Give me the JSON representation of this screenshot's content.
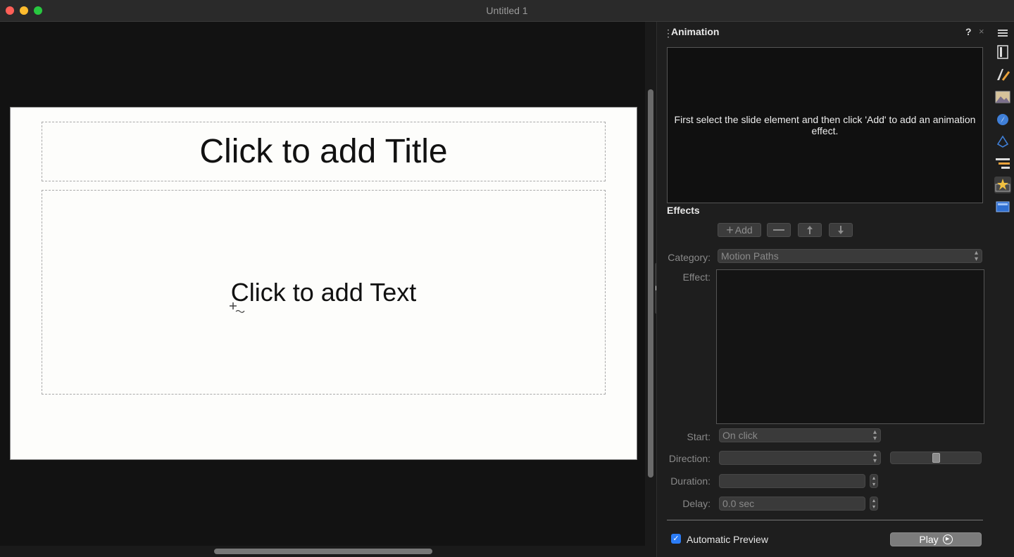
{
  "window": {
    "title": "Untitled 1"
  },
  "slide": {
    "title_placeholder": "Click to add Title",
    "text_placeholder": "Click to add Text"
  },
  "panel": {
    "title": "Animation",
    "help": "?",
    "close": "×",
    "preview_message": "First select the slide element and then click 'Add' to add an animation effect.",
    "effects_heading": "Effects",
    "toolbar": {
      "add_label": "Add"
    },
    "category": {
      "label": "Category:",
      "value": "Motion Paths"
    },
    "effect": {
      "label": "Effect:"
    },
    "start": {
      "label": "Start:",
      "value": "On click"
    },
    "direction": {
      "label": "Direction:",
      "value": ""
    },
    "duration": {
      "label": "Duration:",
      "value": ""
    },
    "delay": {
      "label": "Delay:",
      "value": "0.0 sec"
    },
    "automatic_preview": {
      "label": "Automatic Preview",
      "checked": true
    },
    "play_label": "Play"
  },
  "sidebar": {
    "items": [
      {
        "icon": "menu-icon"
      },
      {
        "icon": "properties-icon"
      },
      {
        "icon": "styles-icon"
      },
      {
        "icon": "gallery-icon"
      },
      {
        "icon": "navigator-icon"
      },
      {
        "icon": "shapes-icon"
      },
      {
        "icon": "slide-transition-icon"
      },
      {
        "icon": "animation-icon",
        "active": true
      },
      {
        "icon": "master-slides-icon"
      }
    ]
  },
  "colors": {
    "accent": "#2b7cf6",
    "background": "#121212",
    "panel": "#1e1e1e"
  }
}
